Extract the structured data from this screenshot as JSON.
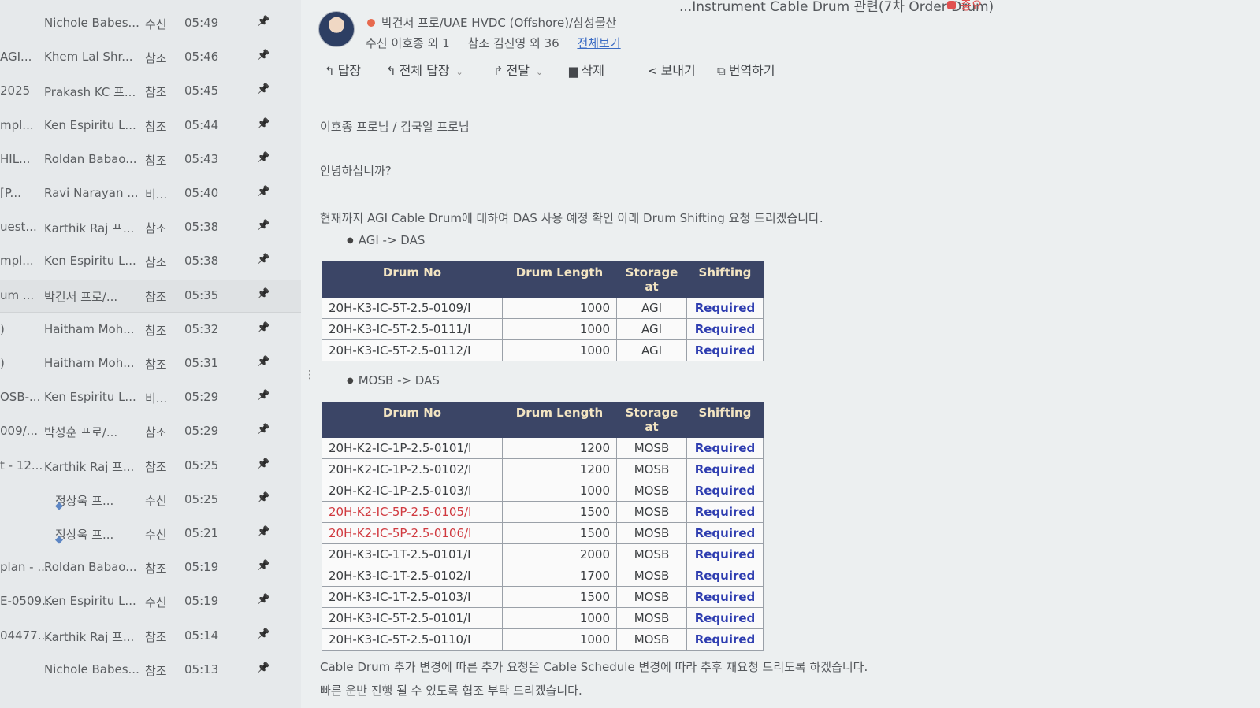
{
  "mail_list": [
    {
      "prefix": "",
      "sender": "Nichole Babes...",
      "flag": "수신",
      "time": "05:49"
    },
    {
      "prefix": "AGI...",
      "sender": "Khem Lal Shr...",
      "flag": "참조",
      "time": "05:46"
    },
    {
      "prefix": "2025",
      "sender": "Prakash KC 프...",
      "flag": "참조",
      "time": "05:45"
    },
    {
      "prefix": "mpl...",
      "sender": "Ken Espiritu L...",
      "flag": "참조",
      "time": "05:44"
    },
    {
      "prefix": "HIL...",
      "sender": "Roldan Babao...",
      "flag": "참조",
      "time": "05:43"
    },
    {
      "prefix": "[P...",
      "sender": "Ravi Narayan ...",
      "flag": "비...",
      "time": "05:40"
    },
    {
      "prefix": "uest...",
      "sender": "Karthik Raj 프...",
      "flag": "참조",
      "time": "05:38"
    },
    {
      "prefix": "mpl...",
      "sender": "Ken Espiritu L...",
      "flag": "참조",
      "time": "05:38"
    },
    {
      "prefix": "um ...",
      "sender": "박건서 프로/...",
      "flag": "참조",
      "time": "05:35",
      "selected": true
    },
    {
      "prefix": ")",
      "sender": "Haitham Moh...",
      "flag": "참조",
      "time": "05:32"
    },
    {
      "prefix": ")",
      "sender": "Haitham Moh...",
      "flag": "참조",
      "time": "05:31"
    },
    {
      "prefix": "OSB-...",
      "sender": "Ken Espiritu L...",
      "flag": "비...",
      "time": "05:29"
    },
    {
      "prefix": "009/...",
      "sender": "박성훈 프로/...",
      "flag": "참조",
      "time": "05:29"
    },
    {
      "prefix": "t - 12...",
      "sender": "Karthik Raj 프...",
      "flag": "참조",
      "time": "05:25"
    },
    {
      "prefix": "",
      "sender": "정상욱 프...",
      "flag": "수신",
      "time": "05:25",
      "shield": true
    },
    {
      "prefix": "",
      "sender": "정상욱 프...",
      "flag": "수신",
      "time": "05:21",
      "shield": true
    },
    {
      "prefix": "plan - ...",
      "sender": "Roldan Babao...",
      "flag": "참조",
      "time": "05:19"
    },
    {
      "prefix": "E-0509...",
      "sender": "Ken Espiritu L...",
      "flag": "수신",
      "time": "05:19"
    },
    {
      "prefix": "04477...",
      "sender": "Karthik Raj 프...",
      "flag": "참조",
      "time": "05:14"
    },
    {
      "prefix": "",
      "sender": "Nichole Babes...",
      "flag": "참조",
      "time": "05:13"
    }
  ],
  "message": {
    "subject": "...Instrument Cable Drum 관련(7차 Order Drum)",
    "importance": "중요",
    "sender": "박건서 프로/UAE HVDC (Offshore)/삼성물산",
    "to_label": "수신",
    "to_value": "이호종 외 1",
    "cc_label": "참조",
    "cc_value": "김진영 외 36",
    "view_all": "전체보기"
  },
  "toolbar": {
    "reply": "답장",
    "reply_all": "전체 답장",
    "forward": "전달",
    "delete": "삭제",
    "send": "보내기",
    "translate": "번역하기"
  },
  "body": {
    "greeting": "이호종 프로님 / 김국일 프로님",
    "hello": "안녕하십니까?",
    "intro": "현재까지 AGI Cable Drum에 대하여 DAS 사용 예정 확인 아래 Drum Shifting 요청 드리겠습니다.",
    "bullet1": "AGI -> DAS",
    "bullet2": "MOSB -> DAS",
    "footer1": "Cable Drum 추가 변경에 따른 추가 요청은 Cable Schedule 변경에 따라 추후 재요청 드리도록 하겠습니다.",
    "footer2": "빠른 운반 진행 될 수 있도록 협조 부탁 드리겠습니다."
  },
  "table_headers": {
    "drum_no": "Drum No",
    "drum_length": "Drum Length",
    "storage": "Storage at",
    "shifting": "Shifting"
  },
  "table_agi": [
    {
      "no": "20H-K3-IC-5T-2.5-0109/I",
      "len": "1000",
      "stor": "AGI",
      "shift": "Required"
    },
    {
      "no": "20H-K3-IC-5T-2.5-0111/I",
      "len": "1000",
      "stor": "AGI",
      "shift": "Required"
    },
    {
      "no": "20H-K3-IC-5T-2.5-0112/I",
      "len": "1000",
      "stor": "AGI",
      "shift": "Required"
    }
  ],
  "table_mosb": [
    {
      "no": "20H-K2-IC-1P-2.5-0101/I",
      "len": "1200",
      "stor": "MOSB",
      "shift": "Required"
    },
    {
      "no": "20H-K2-IC-1P-2.5-0102/I",
      "len": "1200",
      "stor": "MOSB",
      "shift": "Required"
    },
    {
      "no": "20H-K2-IC-1P-2.5-0103/I",
      "len": "1000",
      "stor": "MOSB",
      "shift": "Required"
    },
    {
      "no": "20H-K2-IC-5P-2.5-0105/I",
      "len": "1500",
      "stor": "MOSB",
      "shift": "Required",
      "highlight": "#d0393f"
    },
    {
      "no": "20H-K2-IC-5P-2.5-0106/I",
      "len": "1500",
      "stor": "MOSB",
      "shift": "Required",
      "highlight": "#d0393f"
    },
    {
      "no": "20H-K3-IC-1T-2.5-0101/I",
      "len": "2000",
      "stor": "MOSB",
      "shift": "Required"
    },
    {
      "no": "20H-K3-IC-1T-2.5-0102/I",
      "len": "1700",
      "stor": "MOSB",
      "shift": "Required"
    },
    {
      "no": "20H-K3-IC-1T-2.5-0103/I",
      "len": "1500",
      "stor": "MOSB",
      "shift": "Required"
    },
    {
      "no": "20H-K3-IC-5T-2.5-0101/I",
      "len": "1000",
      "stor": "MOSB",
      "shift": "Required"
    },
    {
      "no": "20H-K3-IC-5T-2.5-0110/I",
      "len": "1000",
      "stor": "MOSB",
      "shift": "Required"
    }
  ],
  "colors": {
    "header_bg": "#3b4566",
    "header_text": "#f2e4c2",
    "required_text": "#2e3db0",
    "importance": "#e05050",
    "link": "#3a6bc4"
  },
  "icons": {
    "pin": "pin-icon",
    "reply": "reply-icon",
    "reply_all": "reply-all-icon",
    "forward": "forward-icon",
    "delete": "trash-icon",
    "send": "share-icon",
    "translate": "translate-icon",
    "shield": "shield-icon"
  }
}
